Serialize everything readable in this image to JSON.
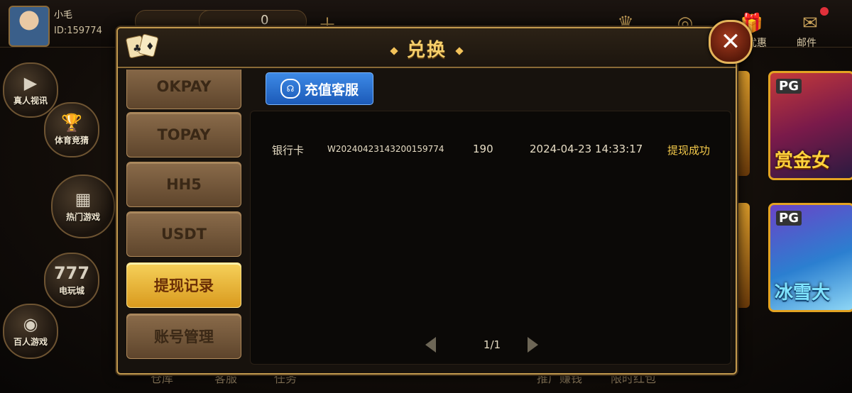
{
  "user": {
    "name": "小毛",
    "id": "ID:159774"
  },
  "topbar": {
    "coins": "0",
    "labels": {
      "discount": "优惠",
      "mail": "邮件"
    }
  },
  "left_rail": [
    {
      "label": "真人视讯",
      "icon": "video-icon"
    },
    {
      "label": "体育竞猜",
      "icon": "trophy-icon"
    },
    {
      "label": "热门游戏",
      "icon": "grid-icon"
    },
    {
      "label": "电玩城",
      "icon": "777-icon"
    },
    {
      "label": "百人游戏",
      "icon": "chip-icon"
    }
  ],
  "bottom_bar": [
    "仓库",
    "客服",
    "任务",
    "推广赚钱",
    "限时红包"
  ],
  "games": [
    {
      "brand": "PG",
      "name": "赏金女"
    },
    {
      "brand": "PG",
      "name": "冰雪大"
    }
  ],
  "modal": {
    "title": "兑换",
    "close_label": "✕",
    "menu": [
      "OKPAY",
      "TOPAY",
      "HH5",
      "USDT",
      "提现记录",
      "账号管理"
    ],
    "active_menu_index": 4,
    "service_button": "充值客服",
    "records": [
      {
        "type": "银行卡",
        "order_id": "W20240423143200159774",
        "amount": "190",
        "time": "2024-04-23 14:33:17",
        "status": "提现成功"
      }
    ],
    "pagination": "1/1"
  },
  "colors": {
    "gold": "#f6cf6a",
    "active_menu": "#d99a1e",
    "status": "#f3c94a",
    "service_blue": "#1c5ab8"
  }
}
